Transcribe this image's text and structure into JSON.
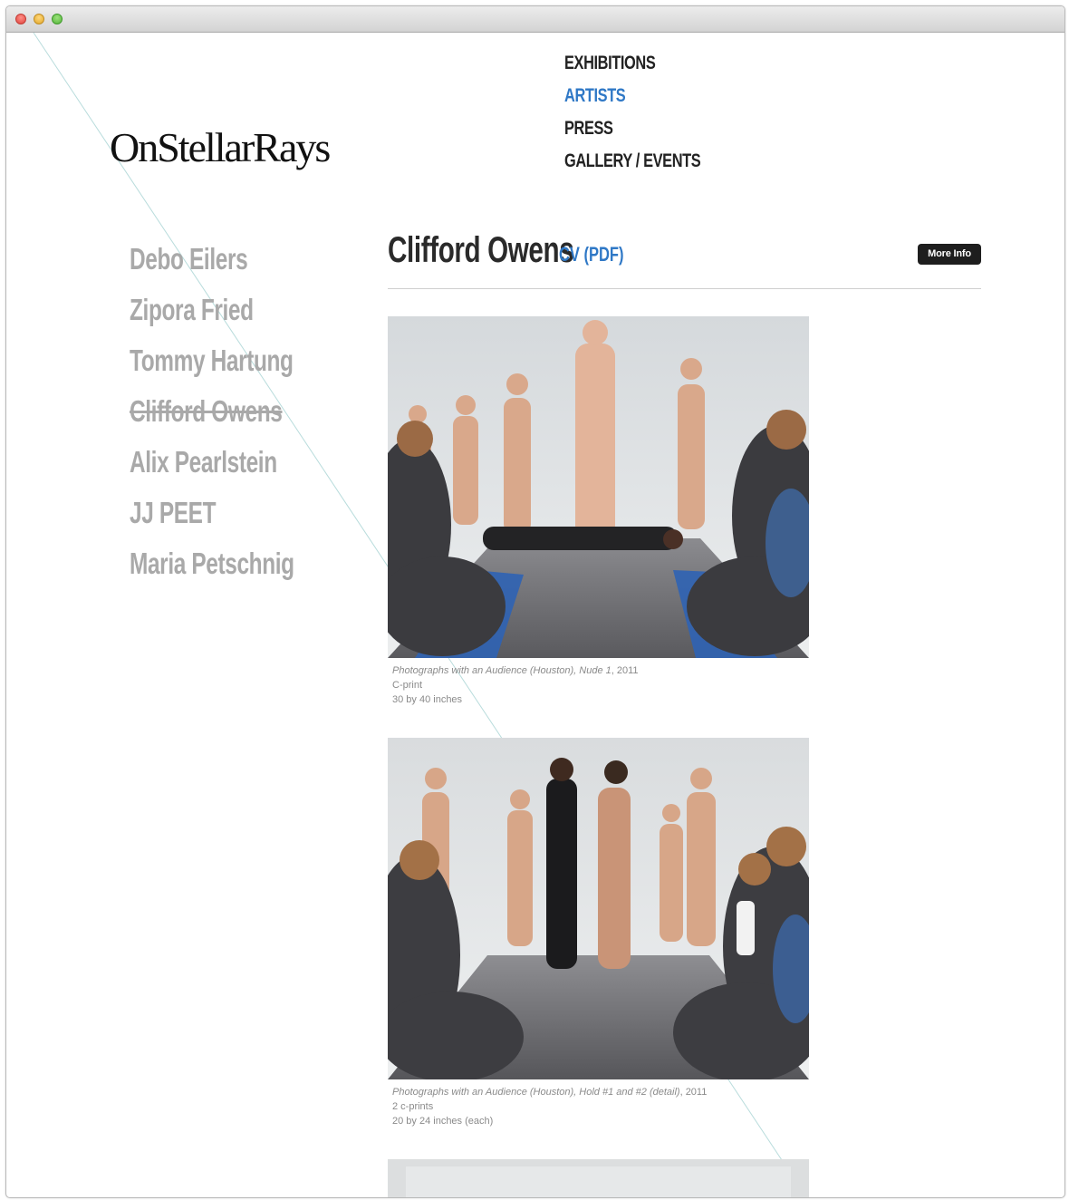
{
  "site": {
    "logo_text": "OnStellarRays"
  },
  "nav": {
    "items": [
      {
        "label": "EXHIBITIONS"
      },
      {
        "label": "ARTISTS"
      },
      {
        "label": "PRESS"
      },
      {
        "label": "GALLERY / EVENTS"
      }
    ],
    "active": "ARTISTS"
  },
  "artists": [
    {
      "name": "Debo Eilers"
    },
    {
      "name": "Zipora Fried"
    },
    {
      "name": "Tommy Hartung"
    },
    {
      "name": "Clifford Owens"
    },
    {
      "name": "Alix Pearlstein"
    },
    {
      "name": "JJ PEET"
    },
    {
      "name": "Maria Petschnig"
    }
  ],
  "artist": {
    "name": "Clifford Owens",
    "cv_label": "CV (PDF)",
    "more_info_label": "More Info"
  },
  "works": [
    {
      "title": "Photographs with an Audience (Houston), Nude 1",
      "year": ", 2011",
      "medium": "C-print",
      "dimensions": "30 by 40 inches"
    },
    {
      "title": "Photographs with an Audience (Houston), Hold #1 and #2 (detail)",
      "year": ", 2011",
      "medium": "2 c-prints",
      "dimensions": "20 by 24 inches (each)"
    }
  ],
  "colors": {
    "accent": "#2f78c6",
    "nav_text": "#222222",
    "artist_list": "#a9a9a9",
    "caption": "#8a8a8a",
    "button_bg": "#1e1e1e"
  }
}
